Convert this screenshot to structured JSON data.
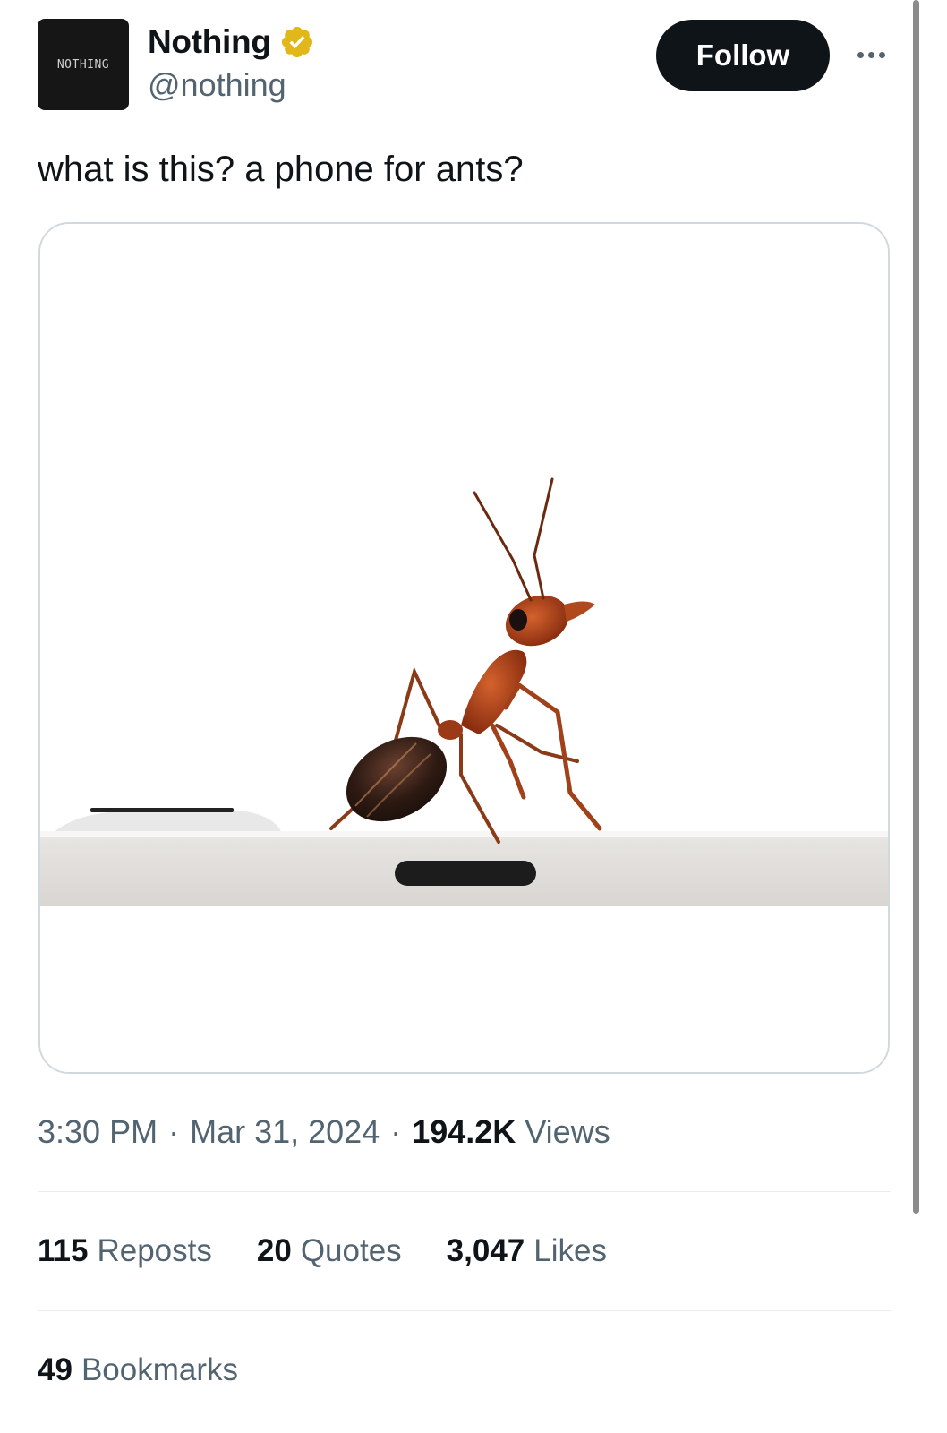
{
  "author": {
    "avatar_text": "NOTHING",
    "display_name": "Nothing",
    "handle": "@nothing",
    "verified_icon": "verified-badge-icon",
    "verified_color": "#e2b719"
  },
  "header": {
    "follow_label": "Follow",
    "more_icon": "more-options-icon"
  },
  "tweet": {
    "text": "what is this? a phone for ants?"
  },
  "media": {
    "description_icon": "ant-on-phone-image"
  },
  "meta": {
    "time": "3:30 PM",
    "separator": "·",
    "date": "Mar 31, 2024",
    "views_count": "194.2K",
    "views_label": "Views"
  },
  "stats": {
    "reposts_count": "115",
    "reposts_label": "Reposts",
    "quotes_count": "20",
    "quotes_label": "Quotes",
    "likes_count": "3,047",
    "likes_label": "Likes",
    "bookmarks_count": "49",
    "bookmarks_label": "Bookmarks"
  },
  "colors": {
    "text_primary": "#0f1419",
    "text_secondary": "#536471",
    "button_bg": "#0f1419",
    "border": "#cfd9de"
  }
}
